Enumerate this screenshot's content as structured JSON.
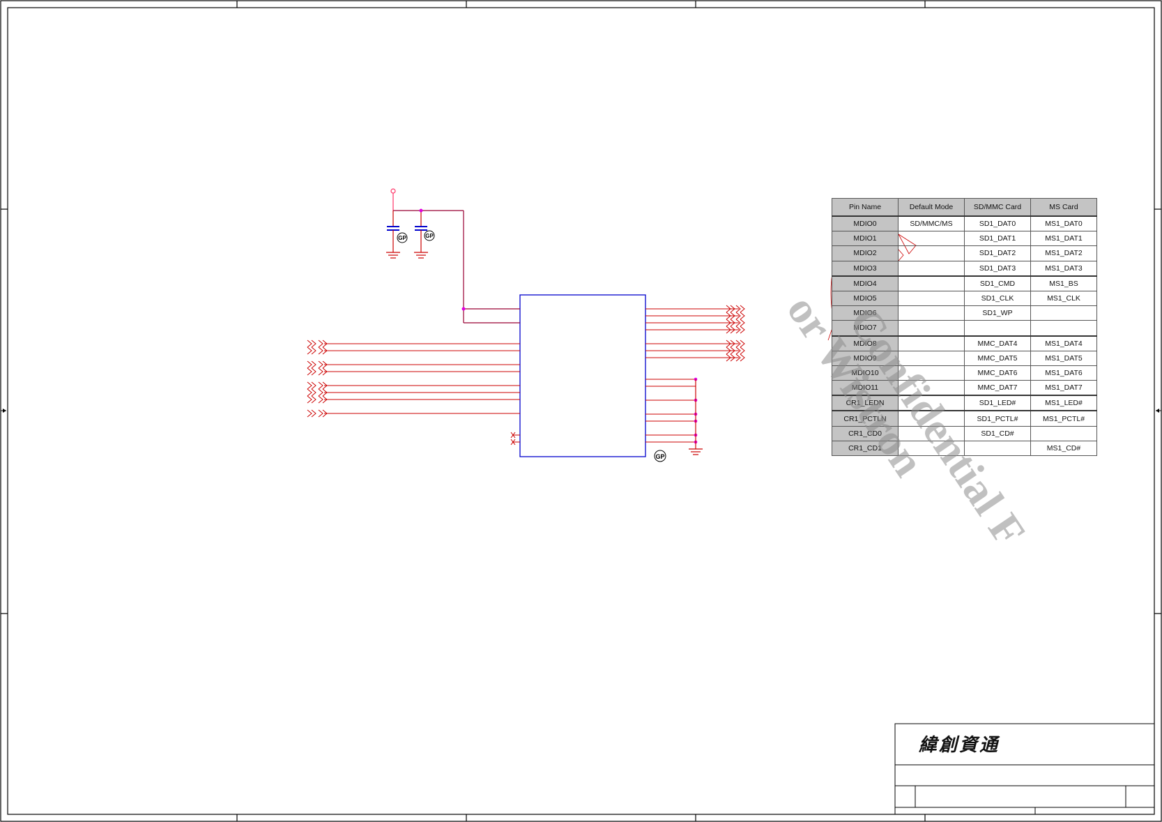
{
  "title_block": {
    "company": "緯創資通"
  },
  "pin_table": {
    "headers": [
      "Pin Name",
      "Default Mode",
      "SD/MMC Card",
      "MS Card"
    ],
    "rows": [
      {
        "pin": "MDIO0",
        "default": "SD/MMC/MS",
        "sdmmc": "SD1_DAT0",
        "ms": "MS1_DAT0"
      },
      {
        "pin": "MDIO1",
        "default": "",
        "sdmmc": "SD1_DAT1",
        "ms": "MS1_DAT1"
      },
      {
        "pin": "MDIO2",
        "default": "",
        "sdmmc": "SD1_DAT2",
        "ms": "MS1_DAT2"
      },
      {
        "pin": "MDIO3",
        "default": "",
        "sdmmc": "SD1_DAT3",
        "ms": "MS1_DAT3"
      },
      {
        "pin": "MDIO4",
        "default": "",
        "sdmmc": "SD1_CMD",
        "ms": "MS1_BS"
      },
      {
        "pin": "MDIO5",
        "default": "",
        "sdmmc": "SD1_CLK",
        "ms": "MS1_CLK"
      },
      {
        "pin": "MDIO6",
        "default": "",
        "sdmmc": "SD1_WP",
        "ms": ""
      },
      {
        "pin": "MDIO7",
        "default": "",
        "sdmmc": "",
        "ms": ""
      },
      {
        "pin": "MDIO8",
        "default": "",
        "sdmmc": "MMC_DAT4",
        "ms": "MS1_DAT4"
      },
      {
        "pin": "MDIO9",
        "default": "",
        "sdmmc": "MMC_DAT5",
        "ms": "MS1_DAT5"
      },
      {
        "pin": "MDIO10",
        "default": "",
        "sdmmc": "MMC_DAT6",
        "ms": "MS1_DAT6"
      },
      {
        "pin": "MDIO11",
        "default": "",
        "sdmmc": "MMC_DAT7",
        "ms": "MS1_DAT7"
      },
      {
        "pin": "CR1_LEDN",
        "default": "",
        "sdmmc": "SD1_LED#",
        "ms": "MS1_LED#"
      },
      {
        "pin": "CR1_PCTLN",
        "default": "",
        "sdmmc": "SD1_PCTL#",
        "ms": "MS1_PCTL#"
      },
      {
        "pin": "CR1_CD0",
        "default": "",
        "sdmmc": "SD1_CD#",
        "ms": ""
      },
      {
        "pin": "CR1_CD1",
        "default": "",
        "sdmmc": "",
        "ms": "MS1_CD#"
      }
    ]
  },
  "watermark": {
    "line1": "Confidential F",
    "line2": "or Wistron"
  },
  "gp_labels": {
    "cap1": "GP",
    "cap2": "GP",
    "chip": "GP"
  },
  "colors": {
    "wire": "#cc0000",
    "chip_outline": "#0000cc",
    "junction": "#e000e0",
    "power": "#ff3366",
    "frame": "#000000"
  }
}
